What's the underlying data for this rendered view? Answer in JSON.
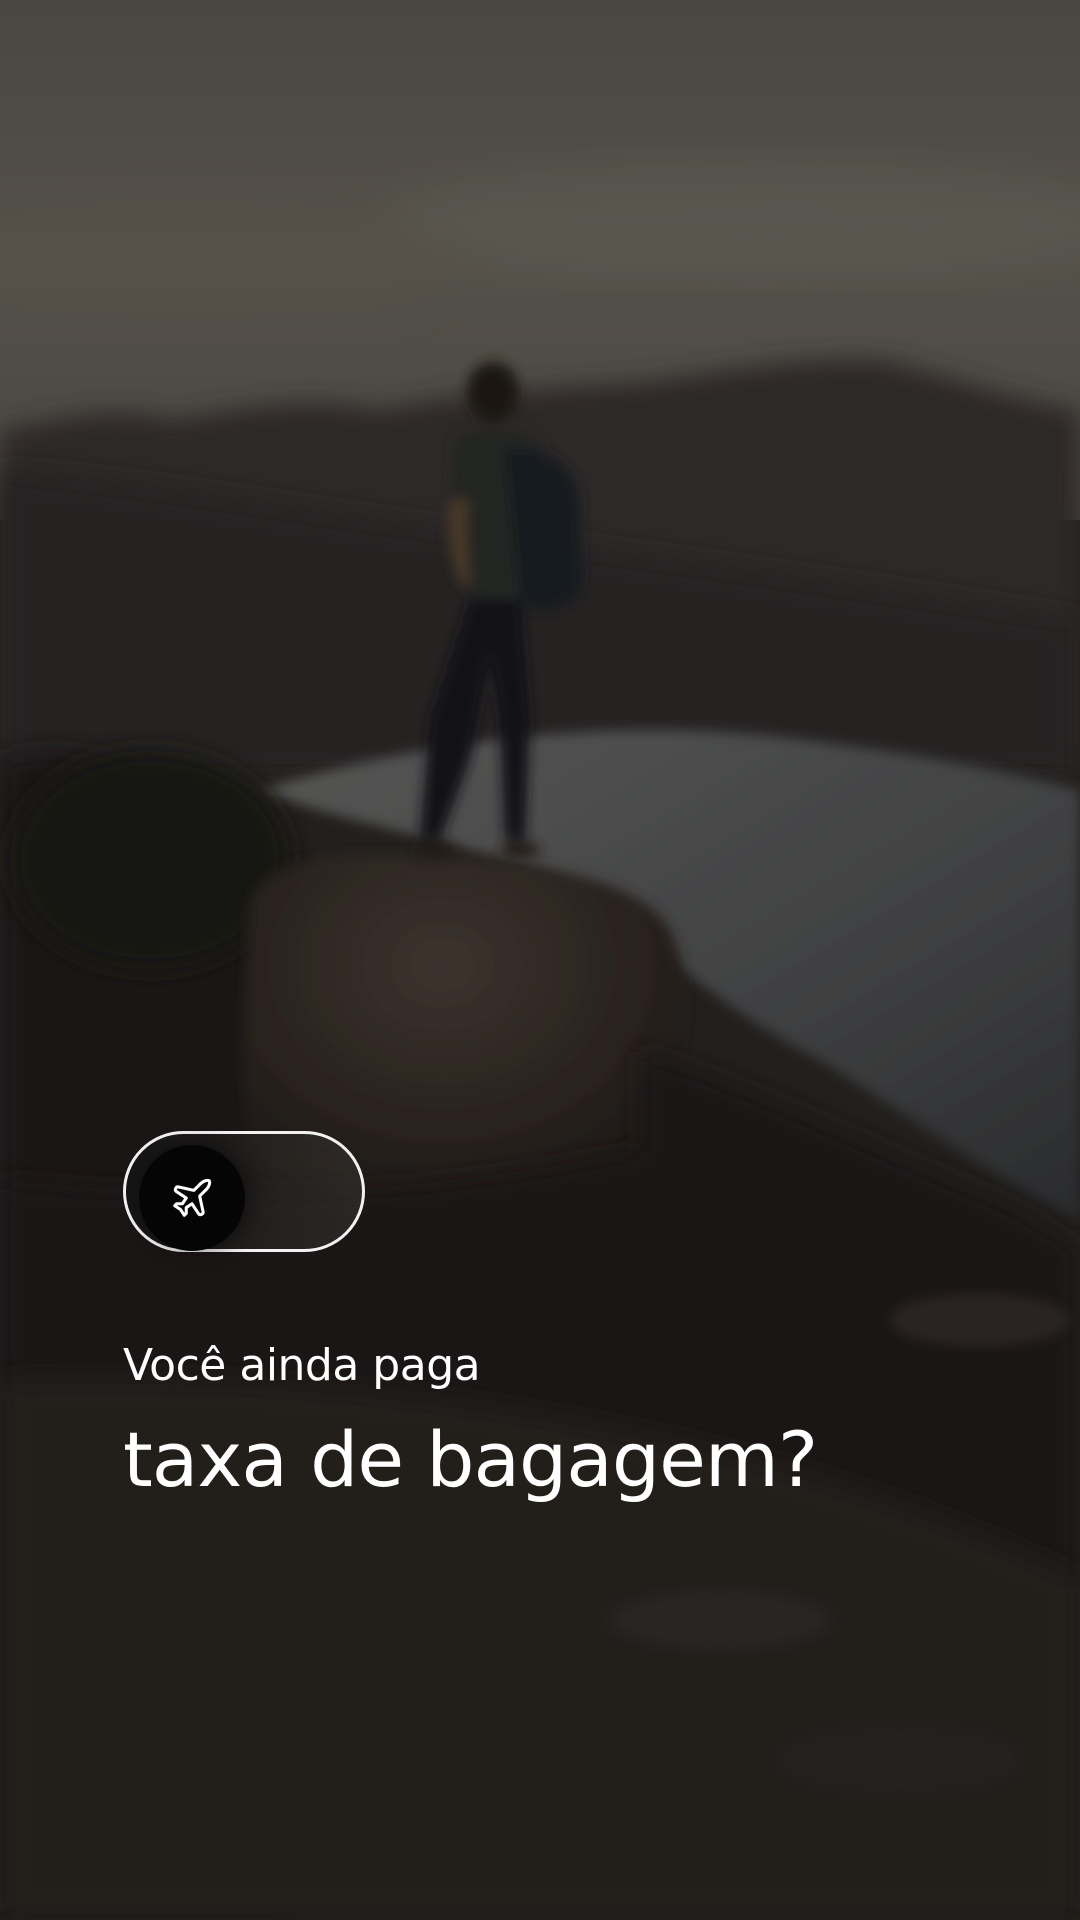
{
  "toggle": {
    "icon": "airplane-icon",
    "state": "off"
  },
  "headline": {
    "line1": "Você ainda paga",
    "line2": "taxa de bagagem?"
  },
  "colors": {
    "text": "#ffffff",
    "toggle_border": "#f2f2f2",
    "toggle_knob": "#050505"
  }
}
